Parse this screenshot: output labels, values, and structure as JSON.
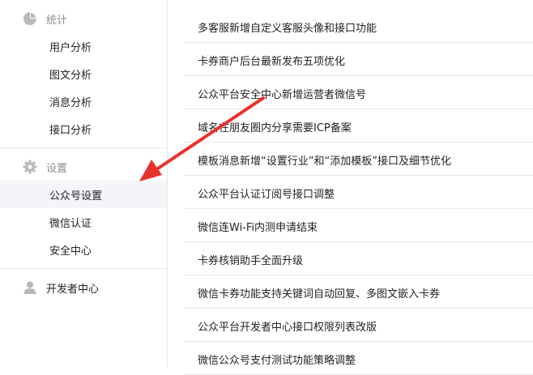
{
  "sidebar": {
    "stats": {
      "title": "统计",
      "icon": "pie-chart-icon",
      "items": [
        "用户分析",
        "图文分析",
        "消息分析",
        "接口分析"
      ]
    },
    "settings": {
      "title": "设置",
      "icon": "gear-icon",
      "items": [
        "公众号设置",
        "微信认证",
        "安全中心"
      ],
      "active_item": "公众号设置"
    },
    "developer": {
      "title": "开发者中心",
      "icon": "user-icon"
    }
  },
  "notices": [
    "多客服新增自定义客服头像和接口功能",
    "卡券商户后台最新发布五项优化",
    "公众平台安全中心新增运营者微信号",
    "域名在朋友圈内分享需要ICP备案",
    "模板消息新增“设置行业”和“添加模板”接口及细节优化",
    "公众平台认证订阅号接口调整",
    "微信连Wi-Fi内测申请结束",
    "卡券核销助手全面升级",
    "微信卡券功能支持关键词自动回复、多图文嵌入卡券",
    "公众平台开发者中心接口权限列表改版",
    "微信公众号支付测试功能策略调整"
  ],
  "colors": {
    "arrow": "#e8312c",
    "active_bg": "#f4f5f9",
    "divider": "#e7e7eb",
    "muted_text": "#8d8d8d"
  }
}
